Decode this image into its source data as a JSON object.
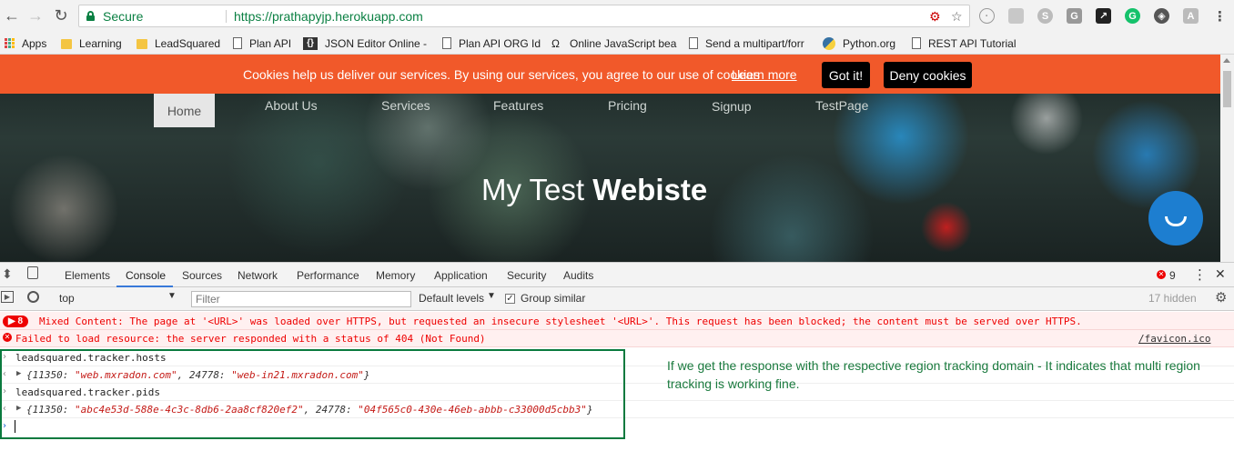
{
  "browser": {
    "secure_label": "Secure",
    "url": "https://prathapyjp.herokuapp.com"
  },
  "bookmarks": [
    {
      "label": "Apps",
      "icon": "apps-grid-icon"
    },
    {
      "label": "Learning",
      "icon": "folder-icon"
    },
    {
      "label": "LeadSquared",
      "icon": "folder-icon"
    },
    {
      "label": "Plan API",
      "icon": "page-icon"
    },
    {
      "label": "JSON Editor Online -",
      "icon": "braces-icon"
    },
    {
      "label": "Plan API ORG Id",
      "icon": "page-icon"
    },
    {
      "label": "Online JavaScript bea",
      "icon": "owl-icon"
    },
    {
      "label": "Send a multipart/forr",
      "icon": "page-icon"
    },
    {
      "label": "Python.org",
      "icon": "python-icon"
    },
    {
      "label": "REST API Tutorial",
      "icon": "page-icon"
    }
  ],
  "cookie_bar": {
    "message": "Cookies help us deliver our services. By using our services, you agree to our use of cookies",
    "learn_more": "Learn more",
    "got_it": "Got it!",
    "deny": "Deny cookies",
    "color": "#f1592a"
  },
  "site_nav": [
    "Home",
    "About Us",
    "Services",
    "Features",
    "Pricing",
    "Signup",
    "TestPage"
  ],
  "hero": {
    "title_regular": "My Test ",
    "title_bold": "Webiste"
  },
  "devtools": {
    "tabs": [
      "Elements",
      "Console",
      "Sources",
      "Network",
      "Performance",
      "Memory",
      "Application",
      "Security",
      "Audits"
    ],
    "active_tab": "Console",
    "error_count": "9",
    "context": "top",
    "filter_placeholder": "Filter",
    "levels": "Default levels",
    "group_similar": "Group similar",
    "hidden": "17 hidden"
  },
  "console": {
    "mixed_badge": "8",
    "mixed_content": "Mixed Content: The page at '<URL>' was loaded over HTTPS, but requested an insecure stylesheet '<URL>'. This request has been blocked; the content must be served over HTTPS.",
    "failed_load": "Failed to load resource: the server responded with a status of 404 (Not Found)",
    "failed_source": "/favicon.ico",
    "cmd1": "leadsquared.tracker.hosts",
    "res1_open": "{11350: ",
    "res1_v1": "\"web.mxradon.com\"",
    "res1_mid": ", 24778: ",
    "res1_v2": "\"web-in21.mxradon.com\"",
    "res1_close": "}",
    "cmd2": "leadsquared.tracker.pids",
    "res2_open": "{11350: ",
    "res2_v1": "\"abc4e53d-588e-4c3c-8db6-2aa8cf820ef2\"",
    "res2_mid": ", 24778: ",
    "res2_v2": "\"04f565c0-430e-46eb-abbb-c33000d5cbb3\"",
    "res2_close": "}"
  },
  "annotation": "If we get the response with the respective region tracking domain - It indicates that multi region tracking is working fine."
}
